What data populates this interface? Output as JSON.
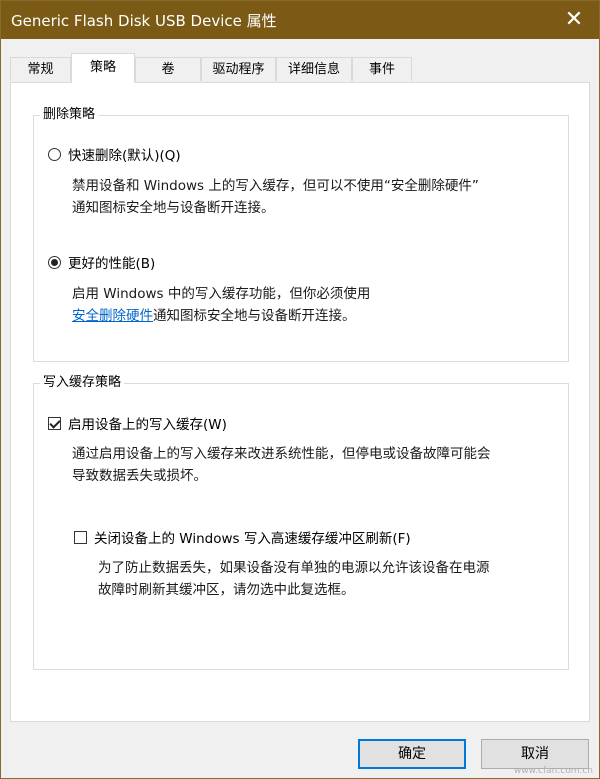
{
  "window": {
    "title": "Generic Flash Disk USB Device 属性",
    "close_glyph": "✕",
    "accent_color": "#7b5a16"
  },
  "tabs": [
    {
      "label": "常规"
    },
    {
      "label": "策略",
      "active": true
    },
    {
      "label": "卷"
    },
    {
      "label": "驱动程序"
    },
    {
      "label": "详细信息"
    },
    {
      "label": "事件"
    }
  ],
  "removal_policy": {
    "legend": "删除策略",
    "quick_removal": {
      "label": "快速删除(默认)(Q)",
      "checked": false,
      "desc_line1": "禁用设备和 Windows 上的写入缓存，但可以不使用“安全删除硬件”",
      "desc_line2": "通知图标安全地与设备断开连接。"
    },
    "better_performance": {
      "label": "更好的性能(B)",
      "checked": true,
      "desc_line1": "启用 Windows 中的写入缓存功能，但你必须使用",
      "link_text": "安全删除硬件",
      "desc_line2_rest": "通知图标安全地与设备断开连接。"
    }
  },
  "write_cache_policy": {
    "legend": "写入缓存策略",
    "enable_cache": {
      "label": "启用设备上的写入缓存(W)",
      "checked": true,
      "desc_line1": "通过启用设备上的写入缓存来改进系统性能，但停电或设备故障可能会",
      "desc_line2": "导致数据丢失或损坏。"
    },
    "disable_flush": {
      "label": "关闭设备上的 Windows 写入高速缓存缓冲区刷新(F)",
      "checked": false,
      "desc_line1": "为了防止数据丢失，如果设备没有单独的电源以允许该设备在电源",
      "desc_line2": "故障时刷新其缓冲区，请勿选中此复选框。"
    }
  },
  "buttons": {
    "ok": "确定",
    "cancel": "取消"
  },
  "watermark": "www.cfan.com.cn"
}
